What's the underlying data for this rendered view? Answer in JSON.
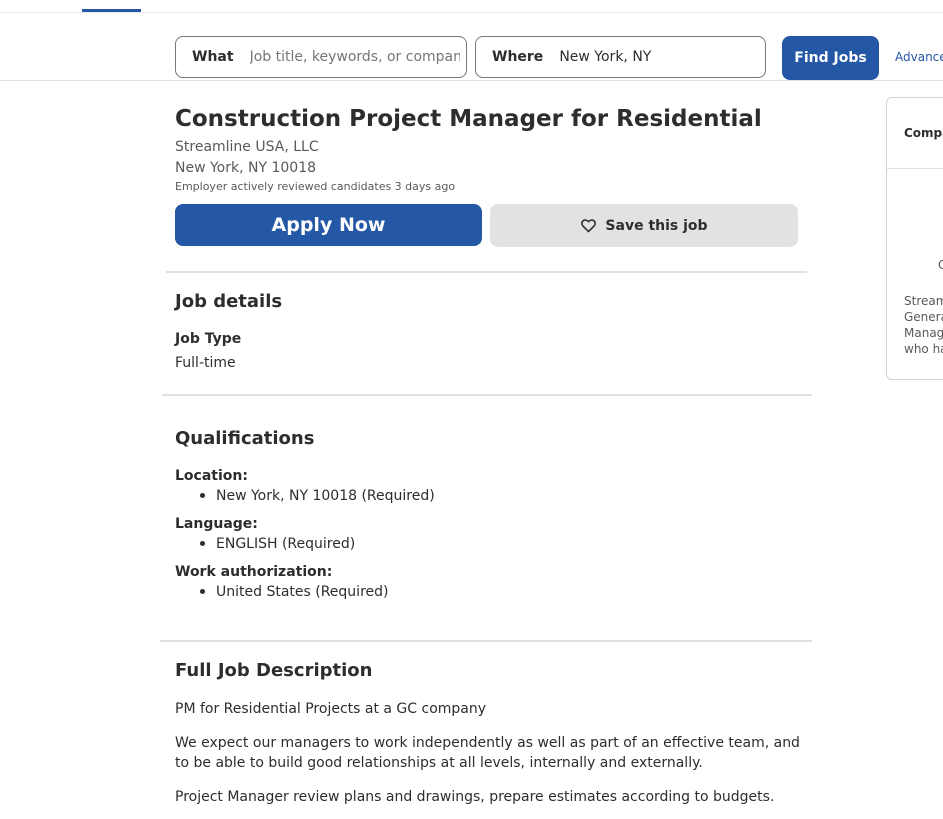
{
  "search": {
    "what_label": "What",
    "what_placeholder": "Job title, keywords, or company",
    "where_label": "Where",
    "where_value": "New York, NY",
    "find_button": "Find Jobs",
    "advanced_link": "Advance"
  },
  "job": {
    "title": "Construction Project Manager for Residential",
    "company": "Streamline USA, LLC",
    "location": "New York, NY 10018",
    "activity": "Employer actively reviewed candidates 3 days ago",
    "apply_button": "Apply Now",
    "save_button": "Save this job"
  },
  "job_details": {
    "heading": "Job details",
    "job_type_label": "Job Type",
    "job_type_value": "Full-time"
  },
  "qualifications": {
    "heading": "Qualifications",
    "items": [
      {
        "label": "Location:",
        "value": "New York, NY 10018 (Required)"
      },
      {
        "label": "Language:",
        "value": "ENGLISH (Required)"
      },
      {
        "label": "Work authorization:",
        "value": "United States (Required)"
      }
    ]
  },
  "description": {
    "heading": "Full Job Description",
    "paragraphs": [
      "PM for Residential Projects at a GC company",
      "We expect our managers to work independently as well as part of an effective team, and to be able to build good relationships at all levels, internally and externally.",
      "Project Manager review plans and drawings, prepare estimates according to budgets."
    ]
  },
  "company_card": {
    "heading": "Compa",
    "letter": "C",
    "text_lines": [
      "Stream",
      "Genera",
      "Manag",
      "who ha"
    ]
  },
  "colors": {
    "accent": "#2557a7",
    "save_bg": "#e4e2e0",
    "text": "#2d2d2d",
    "muted": "#595959"
  },
  "icons": {
    "save": "heart-icon"
  }
}
